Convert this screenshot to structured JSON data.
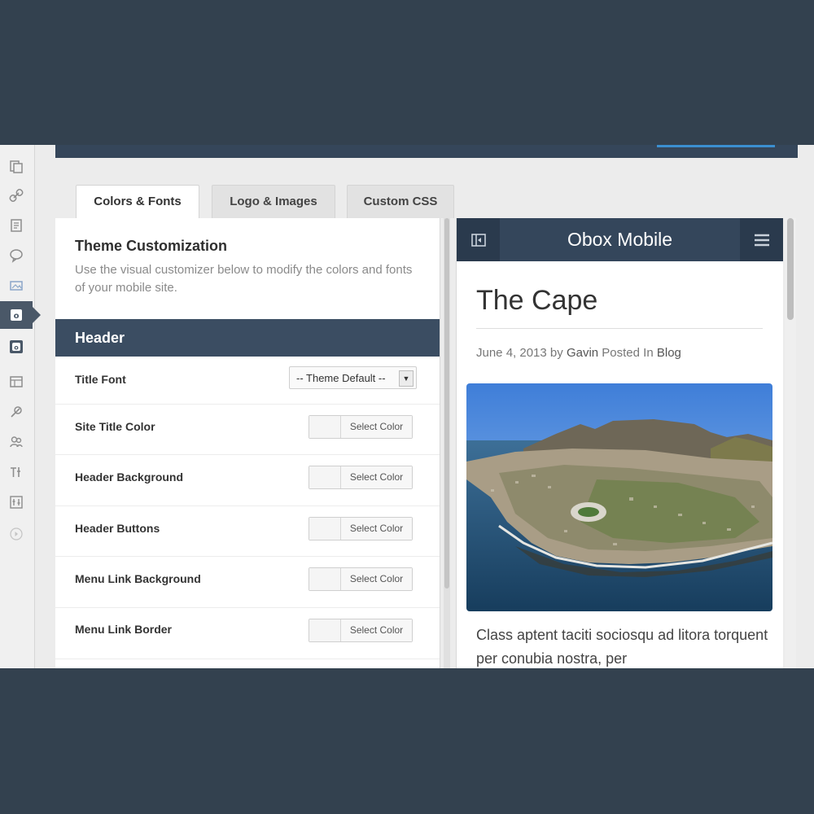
{
  "tabs": [
    {
      "label": "Colors & Fonts",
      "active": true
    },
    {
      "label": "Logo & Images",
      "active": false
    },
    {
      "label": "Custom CSS",
      "active": false
    }
  ],
  "intro": {
    "title": "Theme Customization",
    "description": "Use the visual customizer below to modify the colors and fonts of your mobile site."
  },
  "section": {
    "title": "Header"
  },
  "settings": [
    {
      "label": "Title Font",
      "control": "select",
      "value": "-- Theme Default --"
    },
    {
      "label": "Site Title Color",
      "control": "color",
      "button": "Select Color"
    },
    {
      "label": "Header Background",
      "control": "color",
      "button": "Select Color"
    },
    {
      "label": "Header Buttons",
      "control": "color",
      "button": "Select Color"
    },
    {
      "label": "Menu Link Background",
      "control": "color",
      "button": "Select Color"
    },
    {
      "label": "Menu Link Border",
      "control": "color",
      "button": "Select Color"
    }
  ],
  "preview": {
    "site_title": "Obox Mobile",
    "post_title": "The Cape",
    "meta_date": "June 4, 2013 by",
    "meta_author": "Gavin",
    "meta_posted": "Posted In",
    "meta_category": "Blog",
    "excerpt": "Class aptent taciti sociosqu ad litora torquent per conubia nostra, per"
  },
  "rail_icons": [
    "pages-icon",
    "links-icon",
    "posts-icon",
    "comments-icon",
    "media-icon",
    "obox-active-icon",
    "obox-icon",
    "appearance-icon",
    "plugins-icon",
    "users-icon",
    "tools-icon",
    "settings-icon",
    "collapse-icon"
  ],
  "colors": {
    "page_bg": "#33414f",
    "header_bar": "#3b4d62",
    "mobile_header": "#34465b",
    "accent": "#3b8fd0"
  }
}
